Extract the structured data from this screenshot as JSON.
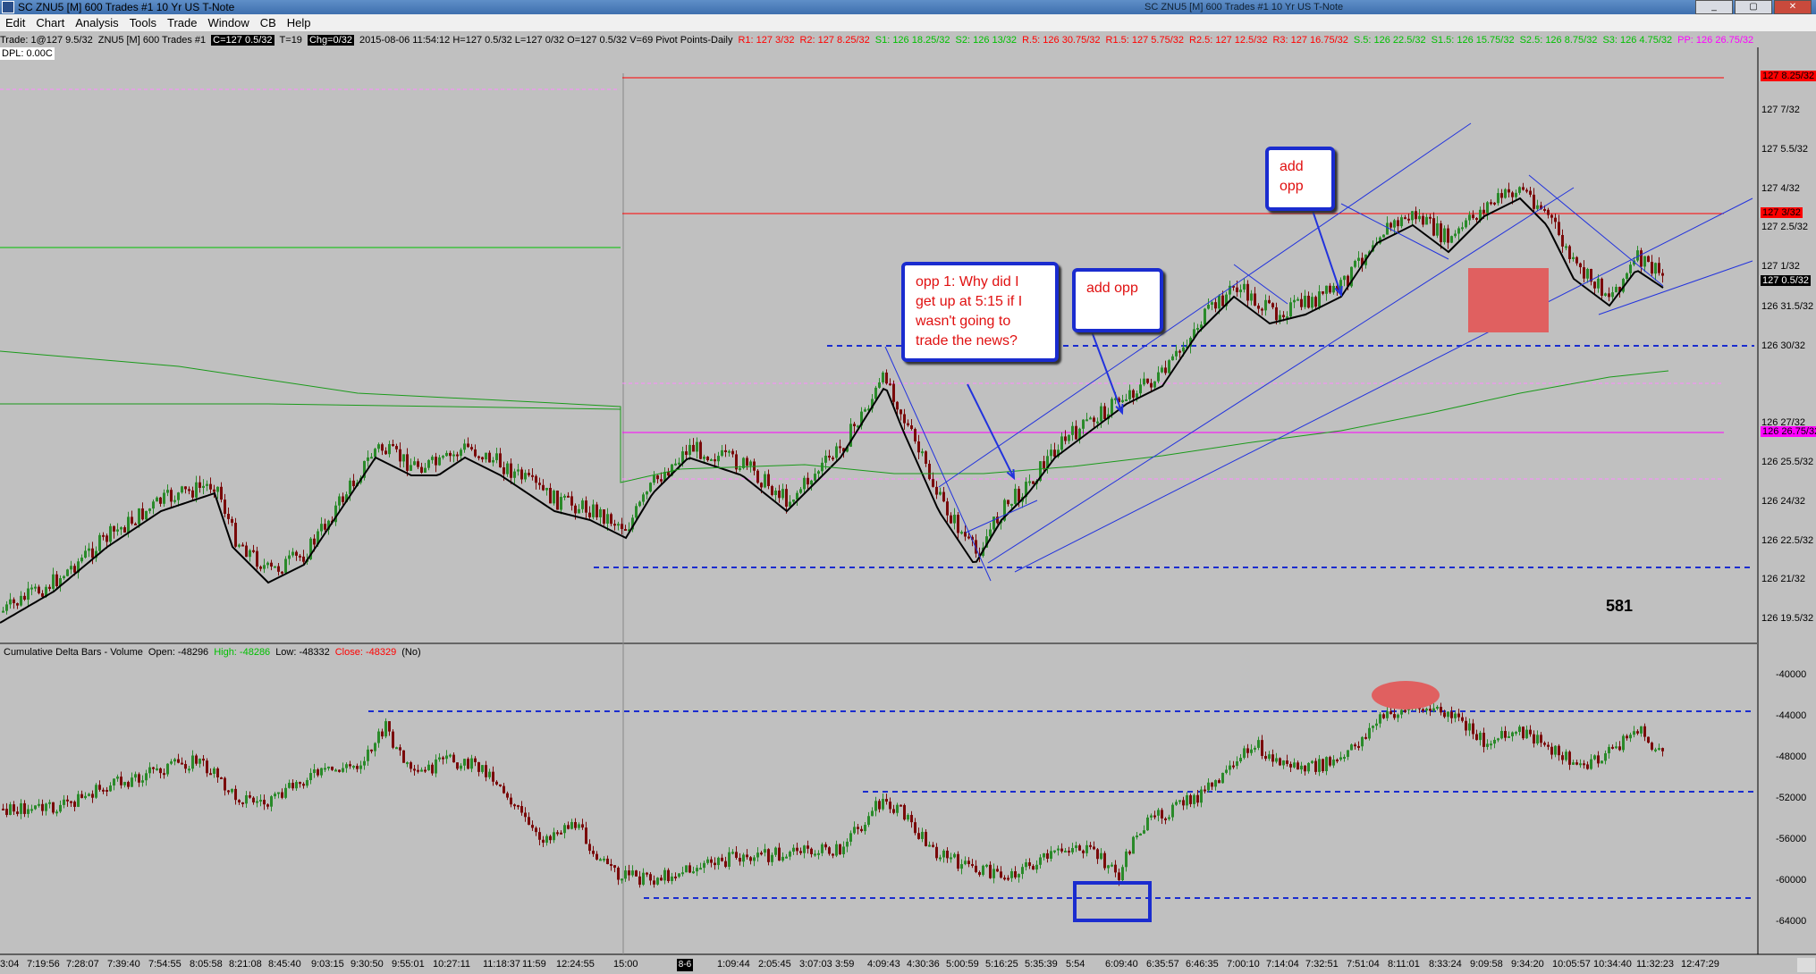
{
  "window": {
    "title": "SC ZNU5 [M]  600 Trades  #1  10 Yr US T-Note",
    "other_window": "SC ZNU5 [M]  600 Trades  #1  10 Yr US T-Note",
    "min_label": "_",
    "max_label": "▢",
    "close_label": "✕"
  },
  "menu": [
    "Edit",
    "Chart",
    "Analysis",
    "Tools",
    "Trade",
    "Window",
    "CB",
    "Help"
  ],
  "info": {
    "trade": "Trade: 1@127 9.5/32",
    "symbol": "ZNU5 [M]  600 Trades  #1",
    "close": "C=127 0.5/32",
    "t": "T=19",
    "chg": "Chg=0/32",
    "ohlc": "2015-08-06 11:54:12 H=127 0.5/32 L=127 0/32 O=127 0.5/32 V=69 Pivot Points-Daily",
    "r1": "R1: 127 3/32",
    "r2": "R2: 127 8.25/32",
    "s1": "S1: 126 18.25/32",
    "s2": "S2: 126 13/32",
    "r5": "R.5: 126 30.75/32",
    "r15": "R1.5: 127 5.75/32",
    "r25": "R2.5: 127 12.5/32",
    "r3": "R3: 127 16.75/32",
    "s5": "S.5: 126 22.5/32",
    "s15": "S1.5: 126 15.75/32",
    "s25": "S2.5: 126 8.75/32",
    "s3": "S3: 126 4.75/32",
    "pp": "PP: 126 26.75/32",
    "colors": {
      "resistance": "#ff0000",
      "support": "#00c000",
      "pivot": "#ff00ff"
    }
  },
  "dpl": "DPL: 0.00C",
  "price_axis": {
    "ticks": [
      "127 7/32",
      "127 5.5/32",
      "127 4/32",
      "127 2.5/32",
      "127 1/32",
      "126 31.5/32",
      "126 30/32",
      "126 27/32",
      "126 25.5/32",
      "126 24/32",
      "126 22.5/32",
      "126 21/32",
      "126 19.5/32"
    ],
    "tags": [
      {
        "text": "127 8.25/32",
        "bg": "#ff0000",
        "color": "#000"
      },
      {
        "text": "127 3/32",
        "bg": "#ff0000",
        "color": "#000"
      },
      {
        "text": "127 0.5/32",
        "bg": "#000",
        "color": "#fff"
      },
      {
        "text": "126 26.75/32",
        "bg": "#ff00ff",
        "color": "#000"
      }
    ]
  },
  "delta_axis": {
    "ticks": [
      "-40000",
      "-44000",
      "-48000",
      "-52000",
      "-56000",
      "-60000",
      "-64000"
    ]
  },
  "time_axis": [
    "3:04",
    "7:19:56",
    "7:28:07",
    "7:39:40",
    "7:54:55",
    "8:05:58",
    "8:21:08",
    "8:45:40",
    "9:03:15",
    "9:30:50",
    "9:55:01",
    "10:27:11",
    "11:18:37",
    "11:59",
    "12:24:55",
    "15:00",
    "8-6",
    "1:09:44",
    "2:05:45",
    "3:07:03",
    "3:59",
    "4:09:43",
    "4:30:36",
    "5:00:59",
    "5:16:25",
    "5:35:39",
    "5:54",
    "6:09:40",
    "6:35:57",
    "6:46:35",
    "7:00:10",
    "7:14:04",
    "7:32:51",
    "7:51:04",
    "8:11:01",
    "8:33:24",
    "9:09:58",
    "9:34:20",
    "10:05:57",
    "10:34:40",
    "11:32:23",
    "12:47:29"
  ],
  "lower": {
    "name": "Cumulative Delta Bars - Volume",
    "open": "Open: -48296",
    "high": "High: -48286",
    "low": "Low: -48332",
    "close": "Close: -48329",
    "no": "(No)"
  },
  "bar_count": "581",
  "callouts": {
    "opp1": [
      "opp 1: Why did I",
      "get up at 5:15 if I",
      "wasn't going to",
      "trade the news?"
    ],
    "add1": "add opp",
    "add2": [
      "add",
      "opp"
    ]
  },
  "colors": {
    "background": "#c0c0c0",
    "up_candle": "#2a8a2a",
    "down_candle": "#7a0a0a",
    "ma_black": "#000000",
    "ma_green": "#1a9a1a",
    "trendline": "#2233dd",
    "highlight": "#e06060"
  }
}
